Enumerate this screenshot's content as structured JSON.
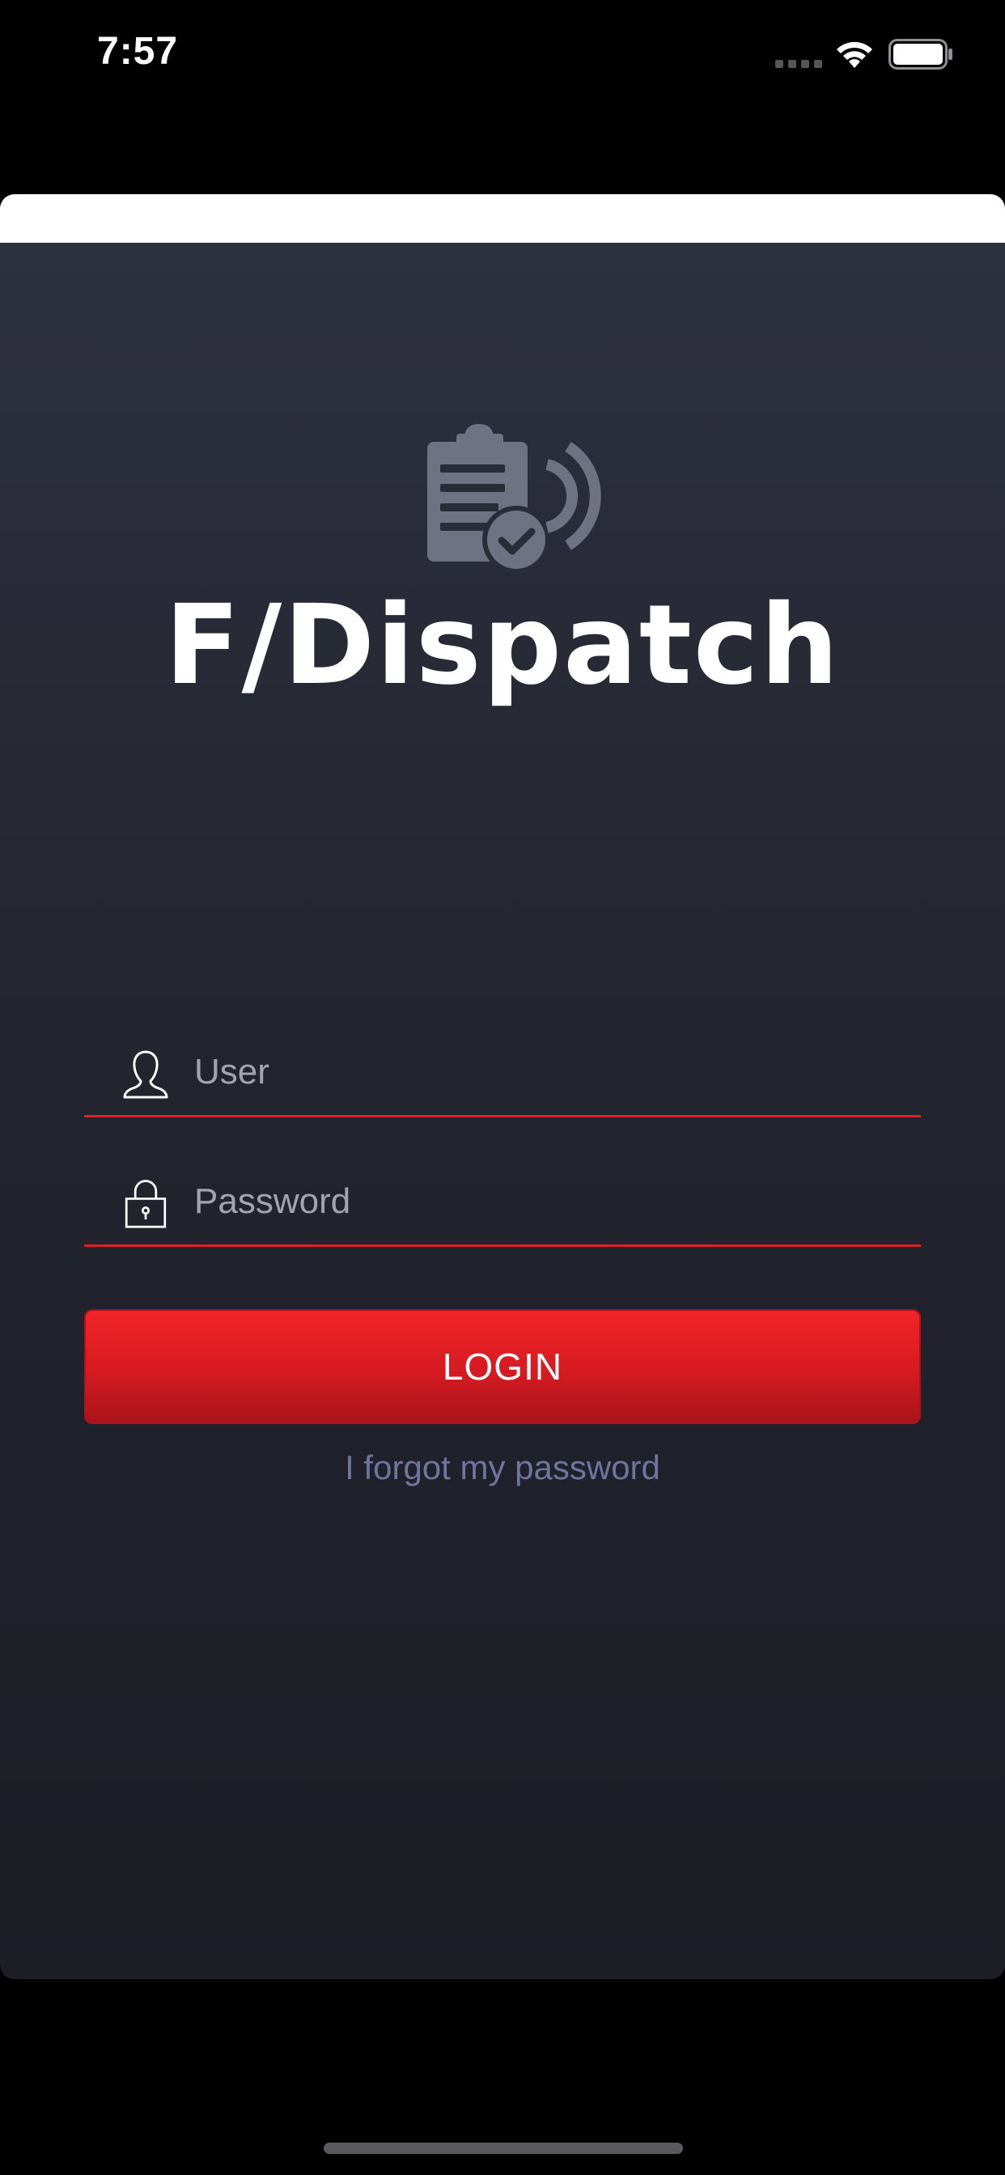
{
  "status_bar": {
    "time": "7:57"
  },
  "app": {
    "title": "F/Dispatch",
    "logo_icon": "clipboard-check-signal-icon"
  },
  "login_form": {
    "user_field": {
      "placeholder": "User",
      "value": "",
      "icon": "user-icon"
    },
    "password_field": {
      "placeholder": "Password",
      "value": "",
      "icon": "lock-icon"
    },
    "login_button_label": "LOGIN",
    "forgot_password_label": "I forgot my password"
  },
  "colors": {
    "accent_red": "#e21f26",
    "background_top": "#2d303e",
    "background_bottom": "#1c1d25",
    "link": "#7274a0",
    "placeholder": "#a2a4ae"
  }
}
